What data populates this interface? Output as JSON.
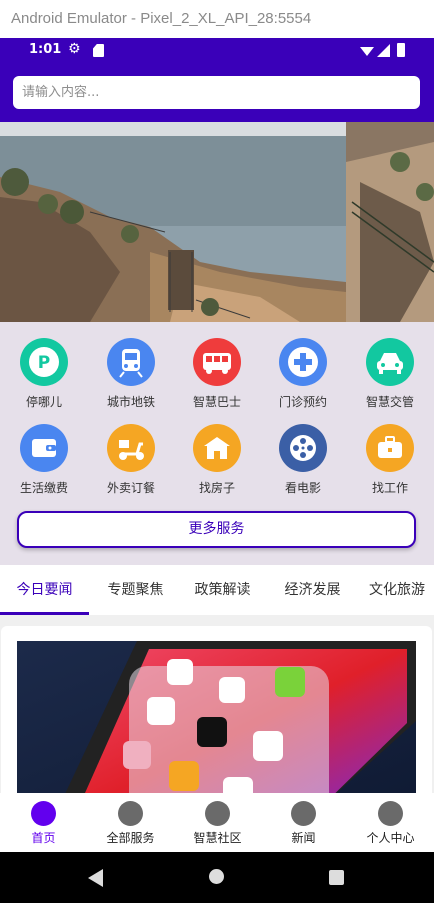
{
  "window": {
    "title": "Android Emulator - Pixel_2_XL_API_28:5554"
  },
  "status_bar": {
    "time": "1:01"
  },
  "search": {
    "placeholder": "请输入内容..."
  },
  "services": [
    {
      "label": "停哪儿",
      "icon": "parking-icon",
      "color": "#12c8a0"
    },
    {
      "label": "城市地铁",
      "icon": "subway-icon",
      "color": "#4a86f0"
    },
    {
      "label": "智慧巴士",
      "icon": "bus-icon",
      "color": "#ef3c3c"
    },
    {
      "label": "门诊预约",
      "icon": "medical-cross-icon",
      "color": "#4a86f0"
    },
    {
      "label": "智慧交管",
      "icon": "car-icon",
      "color": "#12c8a0"
    },
    {
      "label": "生活缴费",
      "icon": "wallet-icon",
      "color": "#4a86f0"
    },
    {
      "label": "外卖订餐",
      "icon": "scooter-icon",
      "color": "#f5a623"
    },
    {
      "label": "找房子",
      "icon": "house-icon",
      "color": "#f5a623"
    },
    {
      "label": "看电影",
      "icon": "film-reel-icon",
      "color": "#3b5fa6"
    },
    {
      "label": "找工作",
      "icon": "briefcase-icon",
      "color": "#f5a623"
    }
  ],
  "more_services": {
    "label": "更多服务"
  },
  "tabs": [
    {
      "label": "今日要闻",
      "active": true
    },
    {
      "label": "专题聚焦",
      "active": false
    },
    {
      "label": "政策解读",
      "active": false
    },
    {
      "label": "经济发展",
      "active": false
    },
    {
      "label": "文化旅游",
      "active": false
    }
  ],
  "bottom_nav": [
    {
      "label": "首页",
      "active": true
    },
    {
      "label": "全部服务",
      "active": false
    },
    {
      "label": "智慧社区",
      "active": false
    },
    {
      "label": "新闻",
      "active": false
    },
    {
      "label": "个人中心",
      "active": false
    }
  ],
  "colors": {
    "primary": "#3a00b9",
    "accent": "#6200ee",
    "services_bg": "#e6e0ea"
  }
}
